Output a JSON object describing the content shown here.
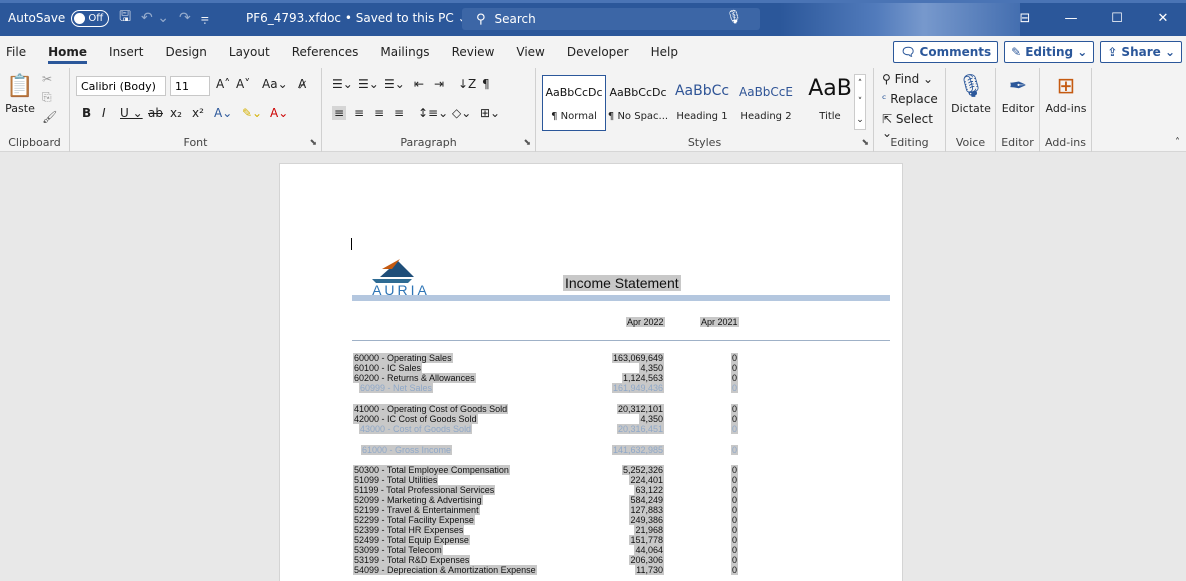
{
  "titlebar": {
    "autosave_label": "AutoSave",
    "autosave_state": "Off",
    "doc_name": "PF6_4793.xfdoc • Saved to this PC ⌄",
    "search_placeholder": "Search"
  },
  "tabs": [
    "File",
    "Home",
    "Insert",
    "Design",
    "Layout",
    "References",
    "Mailings",
    "Review",
    "View",
    "Developer",
    "Help"
  ],
  "active_tab": "Home",
  "tab_actions": {
    "comments": "Comments",
    "editing": "Editing ⌄",
    "share": "Share ⌄"
  },
  "ribbon": {
    "clipboard": {
      "paste": "Paste",
      "label": "Clipboard"
    },
    "font": {
      "family": "Calibri (Body)",
      "size": "11",
      "label": "Font"
    },
    "paragraph": {
      "label": "Paragraph"
    },
    "styles": {
      "label": "Styles",
      "items": [
        {
          "sample": "AaBbCcDc",
          "name": "¶ Normal"
        },
        {
          "sample": "AaBbCcDc",
          "name": "¶ No Spac..."
        },
        {
          "sample": "AaBbCc",
          "name": "Heading 1"
        },
        {
          "sample": "AaBbCcE",
          "name": "Heading 2"
        },
        {
          "sample": "AaB",
          "name": "Title"
        }
      ]
    },
    "editing": {
      "find": "Find ⌄",
      "replace": "Replace",
      "select": "Select ⌄",
      "label": "Editing"
    },
    "voice": {
      "dictate": "Dictate",
      "label": "Voice"
    },
    "editor": {
      "button": "Editor",
      "label": "Editor"
    },
    "addins": {
      "button": "Add-ins",
      "label": "Add-ins"
    }
  },
  "document": {
    "company": "AURIA",
    "title": "Income Statement",
    "col1": "Apr 2022",
    "col2": "Apr 2021",
    "rows": [
      {
        "acct": "60000 - Operating Sales",
        "v1": "163,069,649",
        "v2": "0"
      },
      {
        "acct": "60100 - IC Sales",
        "v1": "4,350",
        "v2": "0"
      },
      {
        "acct": "60200 - Returns & Allowances",
        "v1": "1,124,563",
        "v2": "0"
      },
      {
        "acct": "60999 - Net Sales",
        "v1": "161,949,436",
        "v2": "0"
      },
      {
        "acct": "41000 - Operating Cost of Goods Sold",
        "v1": "20,312,101",
        "v2": "0"
      },
      {
        "acct": "42000 - IC Cost of Goods Sold",
        "v1": "4,350",
        "v2": "0"
      },
      {
        "acct": "43000 - Cost of Goods Sold",
        "v1": "20,316,451",
        "v2": "0"
      },
      {
        "acct": "61000 - Gross Income",
        "v1": "141,632,985",
        "v2": "0"
      },
      {
        "acct": "50300 - Total Employee Compensation",
        "v1": "5,252,326",
        "v2": "0"
      },
      {
        "acct": "51099 - Total Utilities",
        "v1": "224,401",
        "v2": "0"
      },
      {
        "acct": "51199 - Total Professional Services",
        "v1": "63,122",
        "v2": "0"
      },
      {
        "acct": "52099 - Marketing & Advertising",
        "v1": "584,249",
        "v2": "0"
      },
      {
        "acct": "52199 - Travel & Entertainment",
        "v1": "127,883",
        "v2": "0"
      },
      {
        "acct": "52299 - Total Facility Expense",
        "v1": "249,386",
        "v2": "0"
      },
      {
        "acct": "52399 - Total HR Expenses",
        "v1": "21,968",
        "v2": "0"
      },
      {
        "acct": "52499 - Total Equip Expense",
        "v1": "151,778",
        "v2": "0"
      },
      {
        "acct": "53099 - Total Telecom",
        "v1": "44,064",
        "v2": "0"
      },
      {
        "acct": "53199 - Total R&D Expenses",
        "v1": "206,306",
        "v2": "0"
      },
      {
        "acct": "54099 - Depreciation & Amortization Expense",
        "v1": "11,730",
        "v2": "0"
      }
    ]
  }
}
